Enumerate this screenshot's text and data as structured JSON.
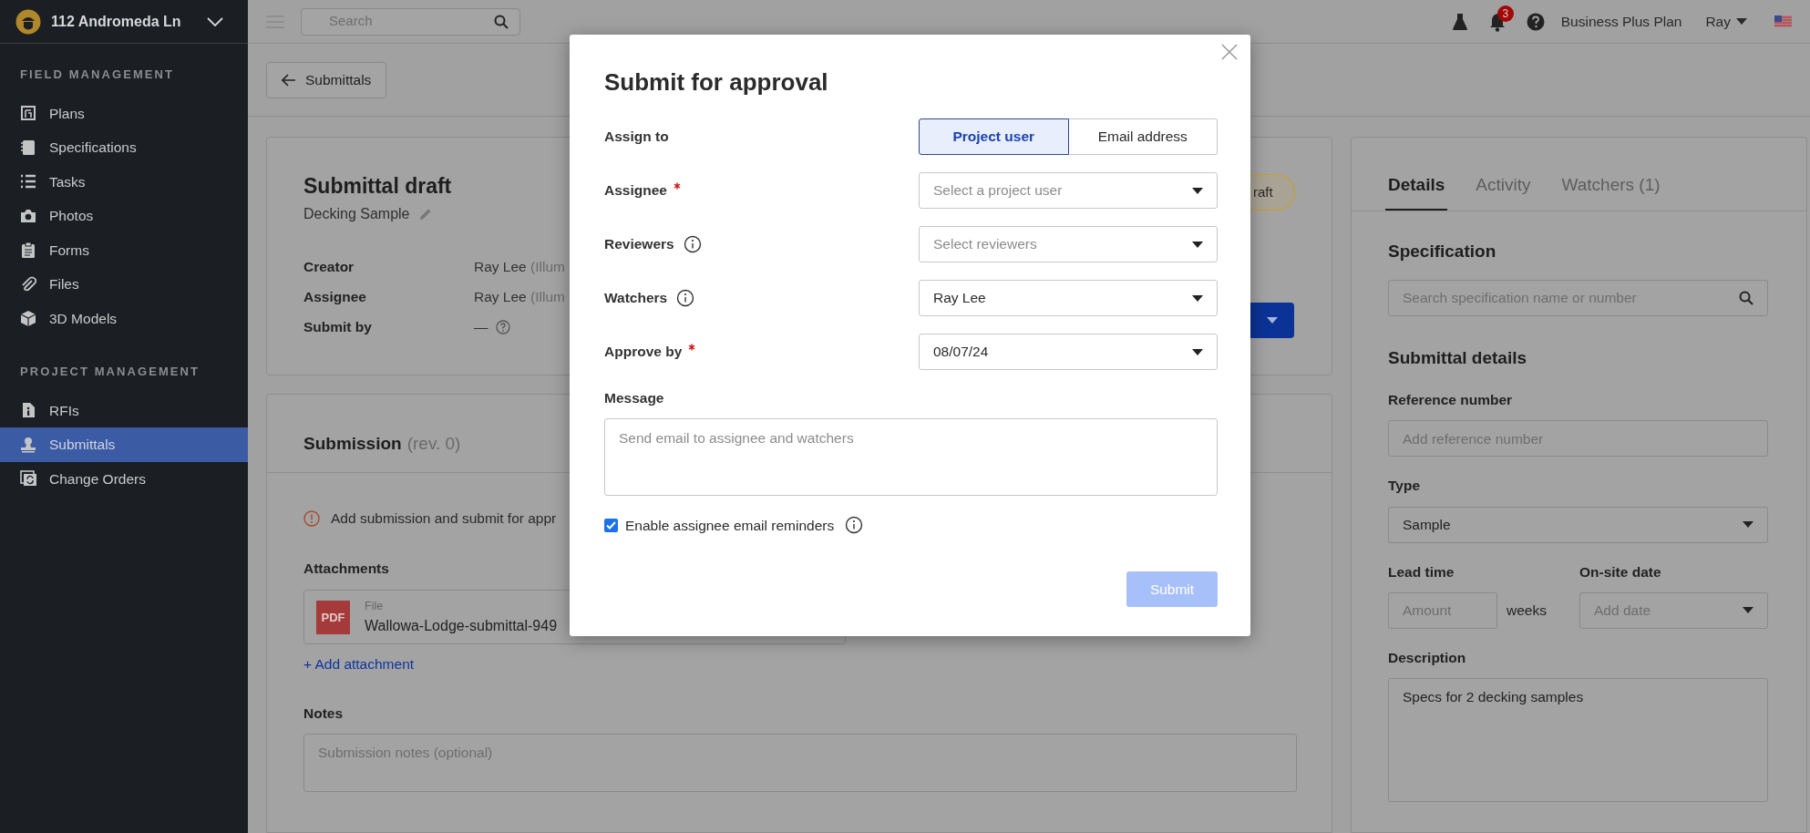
{
  "project": {
    "name": "112 Andromeda Ln"
  },
  "sidebar": {
    "sections": [
      {
        "heading": "FIELD MANAGEMENT",
        "items": [
          {
            "label": "Plans",
            "selected": false
          },
          {
            "label": "Specifications",
            "selected": false
          },
          {
            "label": "Tasks",
            "selected": false
          },
          {
            "label": "Photos",
            "selected": false
          },
          {
            "label": "Forms",
            "selected": false
          },
          {
            "label": "Files",
            "selected": false
          },
          {
            "label": "3D Models",
            "selected": false
          }
        ]
      },
      {
        "heading": "PROJECT MANAGEMENT",
        "items": [
          {
            "label": "RFIs",
            "selected": false
          },
          {
            "label": "Submittals",
            "selected": true
          },
          {
            "label": "Change Orders",
            "selected": false
          }
        ]
      }
    ]
  },
  "top_bar": {
    "search": {
      "placeholder": "Search"
    },
    "notification_count": "3",
    "plan": "Business Plus Plan",
    "user": "Ray"
  },
  "back_button": "Submittals",
  "draft_card": {
    "title": "Submittal draft",
    "subtitle": "Decking Sample",
    "status_badge": "raft",
    "fields": [
      {
        "label": "Creator",
        "value": "Ray Lee",
        "note": "(Illum"
      },
      {
        "label": "Assignee",
        "value": "Ray Lee",
        "note": "(Illum"
      },
      {
        "label": "Submit by",
        "value": "—",
        "help": true
      }
    ]
  },
  "submission_card": {
    "title": "Submission",
    "revision": "(rev. 0)",
    "warning": "Add submission and submit for appr",
    "attachments_label": "Attachments",
    "attachment": {
      "icon_text": "PDF",
      "type": "File",
      "name": "Wallowa-Lodge-submittal-949"
    },
    "add_attachment": "+ Add attachment",
    "notes_label": "Notes",
    "notes_placeholder": "Submission notes (optional)"
  },
  "details_panel": {
    "tabs": [
      {
        "label": "Details",
        "selected": true
      },
      {
        "label": "Activity",
        "selected": false
      },
      {
        "label": "Watchers (1)",
        "selected": false
      }
    ],
    "specification": {
      "heading": "Specification",
      "placeholder": "Search specification name or number"
    },
    "details_heading": "Submittal details",
    "reference": {
      "label": "Reference number",
      "placeholder": "Add reference number"
    },
    "type": {
      "label": "Type",
      "value": "Sample"
    },
    "lead_time": {
      "label": "Lead time",
      "placeholder": "Amount",
      "unit": "weeks"
    },
    "onsite_date": {
      "label": "On-site date",
      "placeholder": "Add date"
    },
    "description": {
      "label": "Description",
      "value": "Specs for 2 decking samples"
    }
  },
  "modal": {
    "title": "Submit for approval",
    "rows": [
      {
        "kind": "segmented",
        "label": "Assign to",
        "required": false,
        "info": false,
        "options": [
          {
            "label": "Project user",
            "selected": true
          },
          {
            "label": "Email address",
            "selected": false
          }
        ]
      },
      {
        "kind": "select",
        "label": "Assignee",
        "required": true,
        "info": false,
        "placeholder": "Select a project user"
      },
      {
        "kind": "select",
        "label": "Reviewers",
        "required": false,
        "info": true,
        "placeholder": "Select reviewers"
      },
      {
        "kind": "select",
        "label": "Watchers",
        "required": false,
        "info": true,
        "value": "Ray Lee"
      },
      {
        "kind": "select",
        "label": "Approve by",
        "required": true,
        "info": false,
        "value": "08/07/24"
      }
    ],
    "message": {
      "label": "Message",
      "placeholder": "Send email to assignee and watchers"
    },
    "reminder": {
      "label": "Enable assignee email reminders",
      "checked": true,
      "info": true
    },
    "submit": {
      "label": "Submit",
      "disabled": true
    }
  }
}
